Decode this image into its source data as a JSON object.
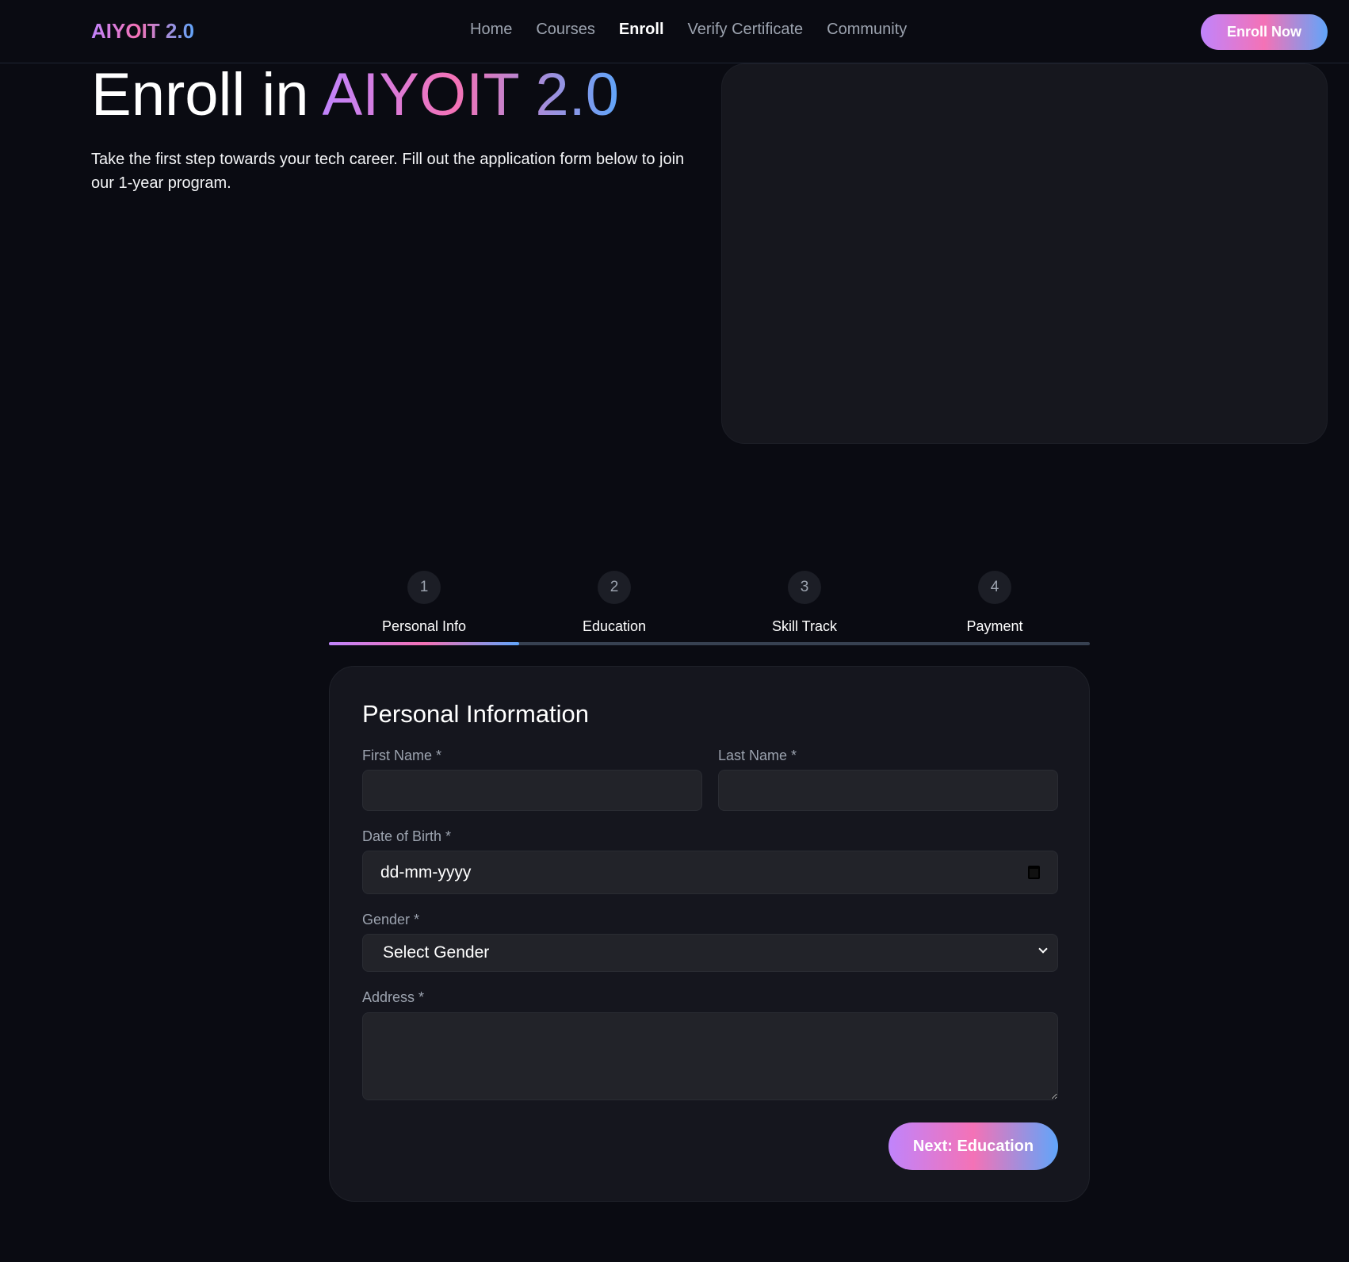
{
  "nav": {
    "logo": "AIYOIT 2.0",
    "links": [
      "Home",
      "Courses",
      "Enroll",
      "Verify Certificate",
      "Community"
    ],
    "active": "Enroll",
    "cta": "Enroll Now"
  },
  "hero": {
    "title_prefix": "Enroll in ",
    "title_highlight": "AIYOIT 2.0",
    "description": "Take the first step towards your tech career. Fill out the application form below to join our 1-year program."
  },
  "steps": [
    {
      "number": "1",
      "label": "Personal Info"
    },
    {
      "number": "2",
      "label": "Education"
    },
    {
      "number": "3",
      "label": "Skill Track"
    },
    {
      "number": "4",
      "label": "Payment"
    }
  ],
  "progress_percent": 25,
  "form": {
    "title": "Personal Information",
    "first_name_label": "First Name *",
    "first_name_value": "",
    "last_name_label": "Last Name *",
    "last_name_value": "",
    "dob_label": "Date of Birth *",
    "dob_placeholder": "dd-mm-yyyy",
    "gender_label": "Gender *",
    "gender_selected": "Select Gender",
    "address_label": "Address *",
    "address_value": "",
    "next_button": "Next: Education"
  },
  "colors": {
    "accent_start": "#c084fc",
    "accent_mid": "#f472b6",
    "accent_end": "#60a5fa",
    "background": "#0a0b12"
  }
}
